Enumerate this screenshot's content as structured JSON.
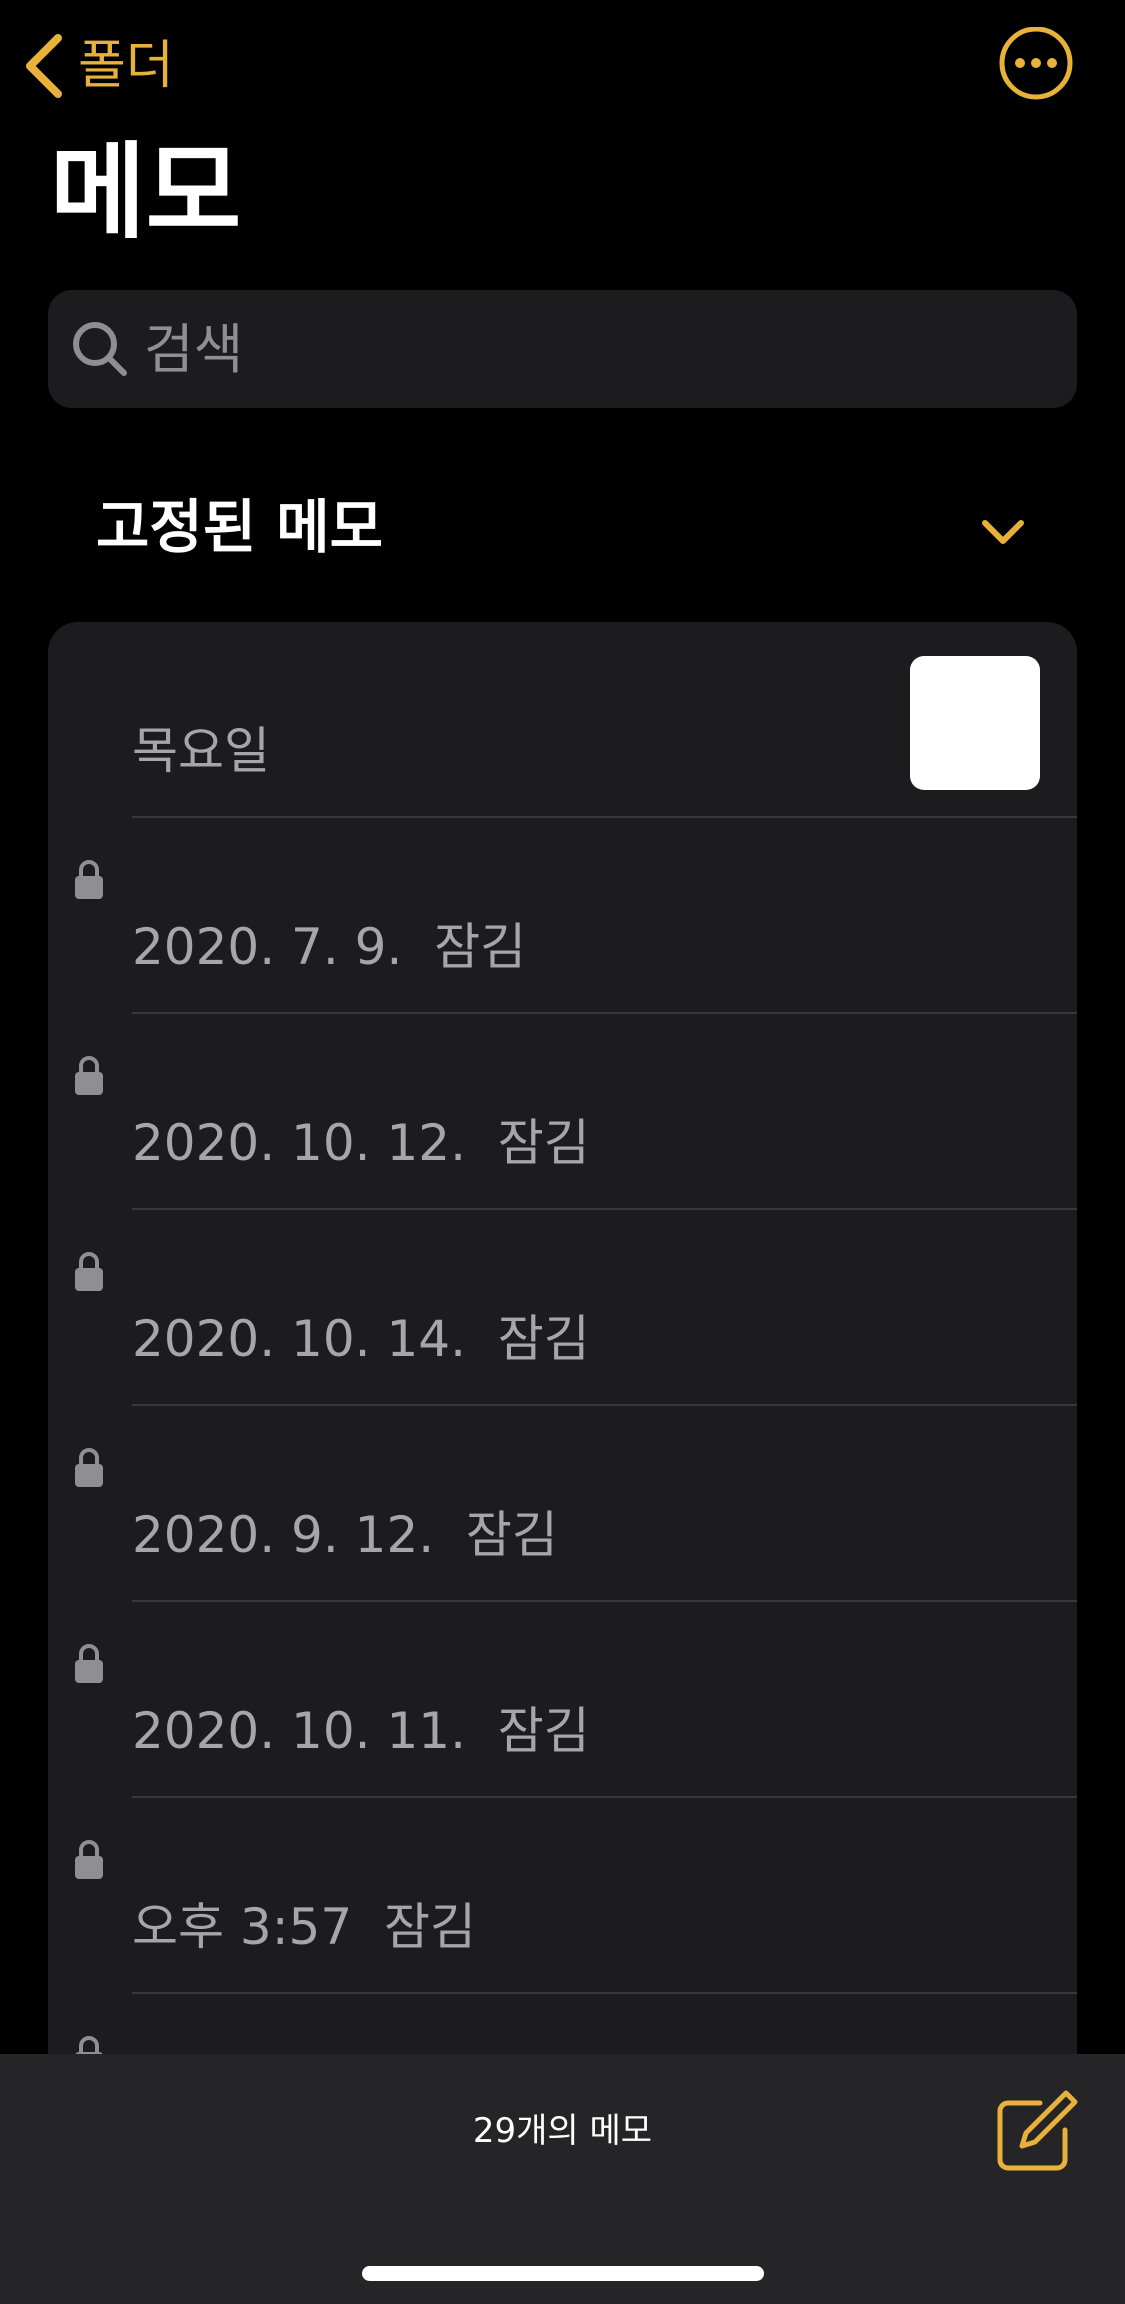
{
  "colors": {
    "accent": "#e8b23a",
    "background": "#000000",
    "card": "#1c1c1e",
    "secondary_text": "#a5a5aa"
  },
  "nav": {
    "back_label": "폴더",
    "back_icon": "chevron-left-icon",
    "more_icon": "ellipsis-circle-icon"
  },
  "title": "메모",
  "search": {
    "placeholder": "검색",
    "icon": "search-icon"
  },
  "pinned_section": {
    "title": "고정된 메모",
    "icon": "chevron-down-icon"
  },
  "notes": [
    {
      "title": "목요일",
      "locked": false,
      "has_thumbnail": true
    },
    {
      "title": "2020. 7. 9.  잠김",
      "locked": true,
      "has_thumbnail": false
    },
    {
      "title": "2020. 10. 12.  잠김",
      "locked": true,
      "has_thumbnail": false
    },
    {
      "title": "2020. 10. 14.  잠김",
      "locked": true,
      "has_thumbnail": false
    },
    {
      "title": "2020. 9. 12.  잠김",
      "locked": true,
      "has_thumbnail": false
    },
    {
      "title": "2020. 10. 11.  잠김",
      "locked": true,
      "has_thumbnail": false
    },
    {
      "title": "오후 3:57  잠김",
      "locked": true,
      "has_thumbnail": false
    },
    {
      "title": "",
      "locked": true,
      "has_thumbnail": false
    }
  ],
  "toolbar": {
    "count_label": "29개의 메모",
    "compose_icon": "compose-icon"
  }
}
